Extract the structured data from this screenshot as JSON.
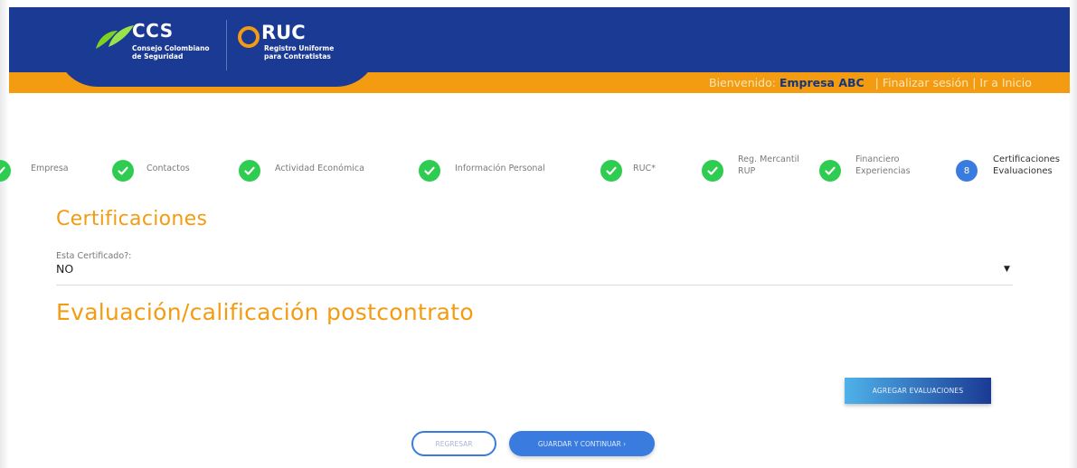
{
  "colors": {
    "header_blue": "#1a3a94",
    "accent_orange": "#f39c12",
    "success_green": "#2ecc50",
    "current_blue": "#3a7be0"
  },
  "header": {
    "ccs_title": "CCS",
    "ccs_subtitle_line1": "Consejo Colombiano",
    "ccs_subtitle_line2": "de Seguridad",
    "ruc_title": "RUC",
    "ruc_subtitle_line1": "Registro Uniforme",
    "ruc_subtitle_line2": "para Contratistas",
    "welcome_prefix": "Bienvenido:",
    "company": "Empresa ABC",
    "separator": "|",
    "logout": "Finalizar sesión",
    "home": "Ir a Inicio"
  },
  "steps": [
    {
      "label": "Empresa",
      "status": "done",
      "icon": "check-icon"
    },
    {
      "label": "Contactos",
      "status": "done",
      "icon": "check-icon"
    },
    {
      "label": "Actividad Económica",
      "status": "done",
      "icon": "check-icon"
    },
    {
      "label": "Información Personal",
      "status": "done",
      "icon": "check-icon"
    },
    {
      "label": "RUC*",
      "status": "done",
      "icon": "check-icon"
    },
    {
      "label_line1": "Reg. Mercantil",
      "label_line2": "RUP",
      "status": "done",
      "icon": "check-icon"
    },
    {
      "label_line1": "Financiero",
      "label_line2": "Experiencias",
      "status": "done",
      "icon": "check-icon"
    },
    {
      "number": "8",
      "label_line1": "Certificaciones",
      "label_line2": "Evaluaciones",
      "status": "current"
    }
  ],
  "certificaciones": {
    "title": "Certificaciones",
    "field_label": "Esta Certificado?:",
    "field_value": "NO"
  },
  "evaluacion": {
    "title": "Evaluación/calificación postcontrato",
    "add_button": "AGREGAR EVALUACIONES"
  },
  "footer": {
    "back_button": "REGRESAR",
    "save_button": "GUARDAR Y CONTINUAR ›"
  }
}
